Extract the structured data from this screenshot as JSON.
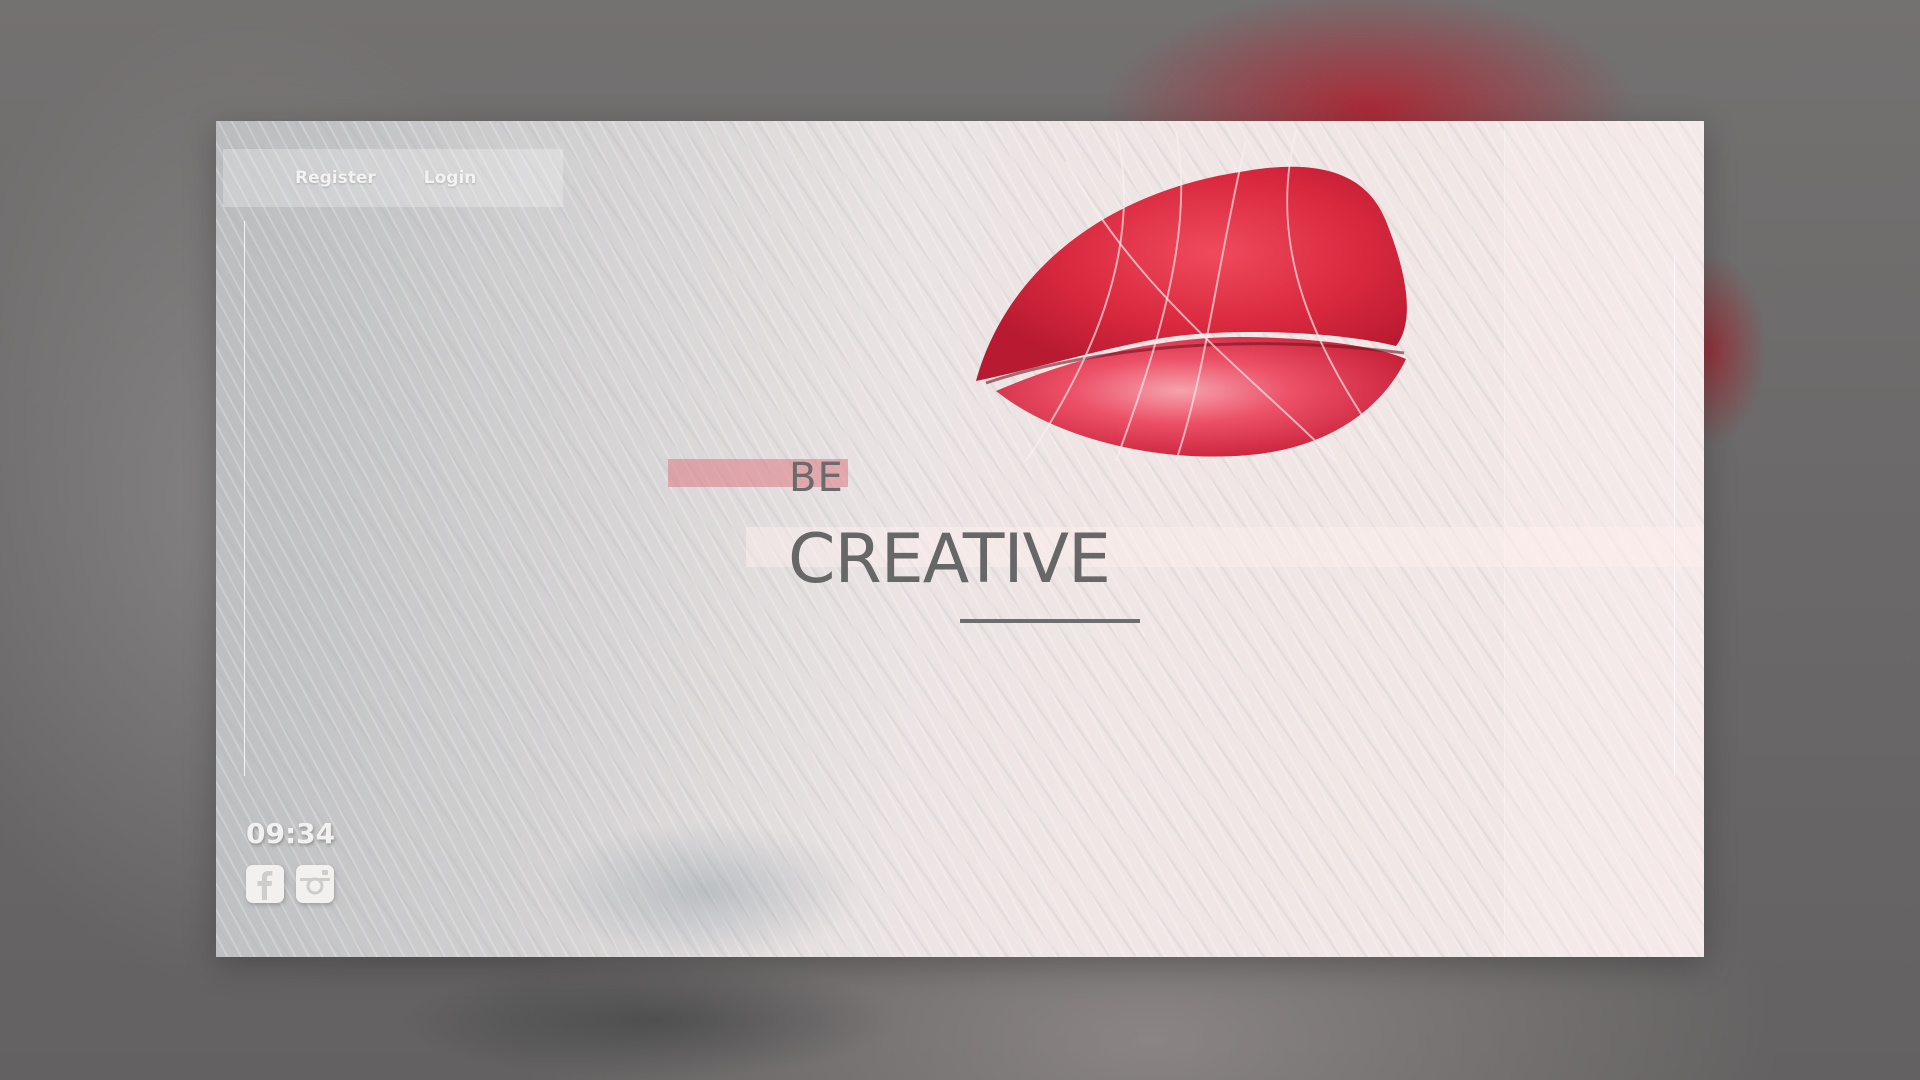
{
  "nav": {
    "register_label": "Register",
    "login_label": "Login"
  },
  "hero": {
    "line1": "BE",
    "line2": "CREATIVE"
  },
  "footer": {
    "time": "09:34",
    "social_icons": [
      "facebook-icon",
      "instagram-icon"
    ]
  },
  "colors": {
    "lip_red": "#d8283e",
    "accent_bar": "#dc7882",
    "headline_gray": "#676767",
    "nav_text": "#f4f2f2"
  }
}
